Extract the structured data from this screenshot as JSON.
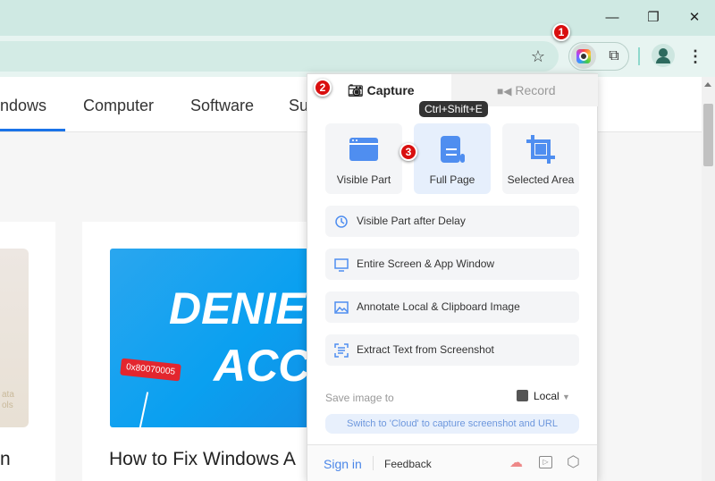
{
  "browser": {
    "window_controls": [
      "minimize",
      "restore",
      "close"
    ],
    "badges": [
      "1",
      "2",
      "3"
    ]
  },
  "nav": {
    "items": [
      "ndows",
      "Computer",
      "Software",
      "Su"
    ]
  },
  "article": {
    "image_text_line1": "DENIE",
    "image_text_line2": "ACC",
    "error_tag": "0x80070005",
    "title": "How to Fix Windows A",
    "left_image_text": [
      "ata",
      "ols"
    ],
    "left_title": "n"
  },
  "popup": {
    "tabs": {
      "capture": "Capture",
      "record": "Record"
    },
    "tooltip": "Ctrl+Shift+E",
    "big_buttons": [
      "Visible Part",
      "Full Page",
      "Selected Area"
    ],
    "rows": [
      "Visible Part after Delay",
      "Entire Screen & App Window",
      "Annotate Local & Clipboard Image",
      "Extract Text from Screenshot"
    ],
    "save_label": "Save image to",
    "save_target": "Local",
    "cloud_hint": "Switch to 'Cloud' to capture screenshot and URL",
    "footer": {
      "sign_in": "Sign in",
      "feedback": "Feedback"
    }
  },
  "colors": {
    "accent": "#4a86e8",
    "badge": "#d90f0f",
    "icon_blue": "#4f8ef0"
  }
}
